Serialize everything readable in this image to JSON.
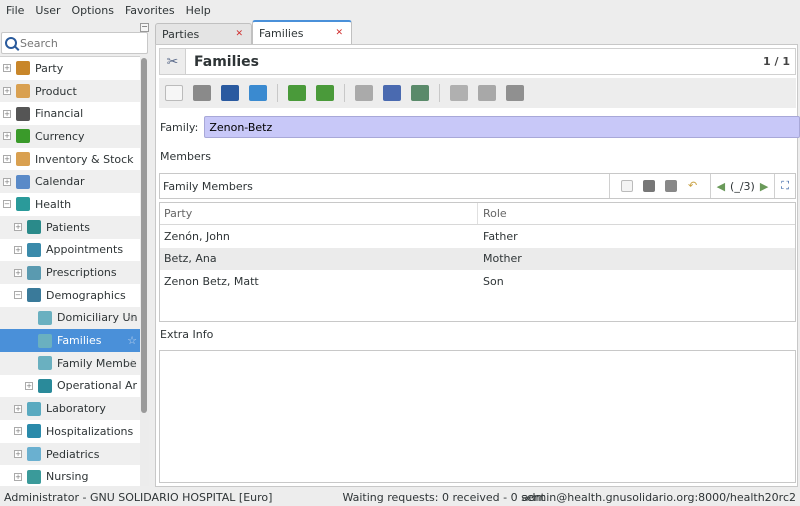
{
  "menu": [
    "File",
    "User",
    "Options",
    "Favorites",
    "Help"
  ],
  "search": {
    "placeholder": "Search"
  },
  "tree": [
    {
      "label": "Party",
      "level": 0,
      "expander": "+",
      "icon": "party-icon",
      "color": "#c8862a"
    },
    {
      "label": "Product",
      "level": 0,
      "expander": "+",
      "icon": "product-box-icon",
      "color": "#d9a050"
    },
    {
      "label": "Financial",
      "level": 0,
      "expander": "+",
      "icon": "calculator-icon",
      "color": "#555555"
    },
    {
      "label": "Currency",
      "level": 0,
      "expander": "+",
      "icon": "currency-icon",
      "color": "#3a9a2a"
    },
    {
      "label": "Inventory & Stock",
      "level": 0,
      "expander": "+",
      "icon": "inventory-box-icon",
      "color": "#d9a050"
    },
    {
      "label": "Calendar",
      "level": 0,
      "expander": "+",
      "icon": "folder-icon",
      "color": "#5a8ac8"
    },
    {
      "label": "Health",
      "level": 0,
      "expander": "−",
      "icon": "health-icon",
      "color": "#2a9a9a"
    },
    {
      "label": "Patients",
      "level": 1,
      "expander": "+",
      "icon": "patient-icon",
      "color": "#2a8a8a"
    },
    {
      "label": "Appointments",
      "level": 1,
      "expander": "+",
      "icon": "clock-icon",
      "color": "#3a8aaa"
    },
    {
      "label": "Prescriptions",
      "level": 1,
      "expander": "+",
      "icon": "rx-icon",
      "color": "#5a9ab0"
    },
    {
      "label": "Demographics",
      "level": 1,
      "expander": "−",
      "icon": "globe-icon",
      "color": "#3a7a9a"
    },
    {
      "label": "Domiciliary Un",
      "level": 2,
      "expander": "",
      "icon": "document-icon",
      "color": "#6ab0c0",
      "star": true
    },
    {
      "label": "Families",
      "level": 2,
      "expander": "",
      "icon": "document-icon",
      "color": "#6ab0c0",
      "star": true,
      "selected": true
    },
    {
      "label": "Family Membe",
      "level": 2,
      "expander": "",
      "icon": "document-icon",
      "color": "#6ab0c0",
      "star": true
    },
    {
      "label": "Operational Ar",
      "level": 2,
      "expander": "+",
      "icon": "folder-icon",
      "color": "#2a8a9a"
    },
    {
      "label": "Laboratory",
      "level": 1,
      "expander": "+",
      "icon": "flask-icon",
      "color": "#5aaac0"
    },
    {
      "label": "Hospitalizations",
      "level": 1,
      "expander": "+",
      "icon": "bed-icon",
      "color": "#2a8aaa"
    },
    {
      "label": "Pediatrics",
      "level": 1,
      "expander": "+",
      "icon": "bottle-icon",
      "color": "#6ab0d0"
    },
    {
      "label": "Nursing",
      "level": 1,
      "expander": "+",
      "icon": "nurse-icon",
      "color": "#3a9a9a"
    }
  ],
  "tabs": [
    {
      "label": "Parties",
      "active": false
    },
    {
      "label": "Families",
      "active": true
    }
  ],
  "form": {
    "title": "Families",
    "record_count": "1 / 1",
    "family_label": "Family:",
    "family_value": "Zenon-Betz",
    "members_label": "Members",
    "extra_label": "Extra Info"
  },
  "toolbar": [
    "new-icon",
    "save-icon",
    "switch-view-icon",
    "reload-icon",
    "|",
    "previous-icon",
    "next-icon",
    "|",
    "attachment-icon",
    "action-icon",
    "relate-icon",
    "|",
    "report-icon",
    "email-icon",
    "print-icon"
  ],
  "members": {
    "title": "Family Members",
    "counter": "(_/3)",
    "columns": [
      "Party",
      "Role"
    ],
    "rows": [
      [
        "Zenón, John",
        "Father"
      ],
      [
        "Betz, Ana",
        "Mother"
      ],
      [
        "Zenon Betz, Matt",
        "Son"
      ]
    ]
  },
  "status": {
    "left": "Administrator - GNU SOLIDARIO HOSPITAL [Euro]",
    "middle": "Waiting requests: 0 received - 0 sent",
    "right": "admin@health.gnusolidario.org:8000/health20rc2"
  }
}
